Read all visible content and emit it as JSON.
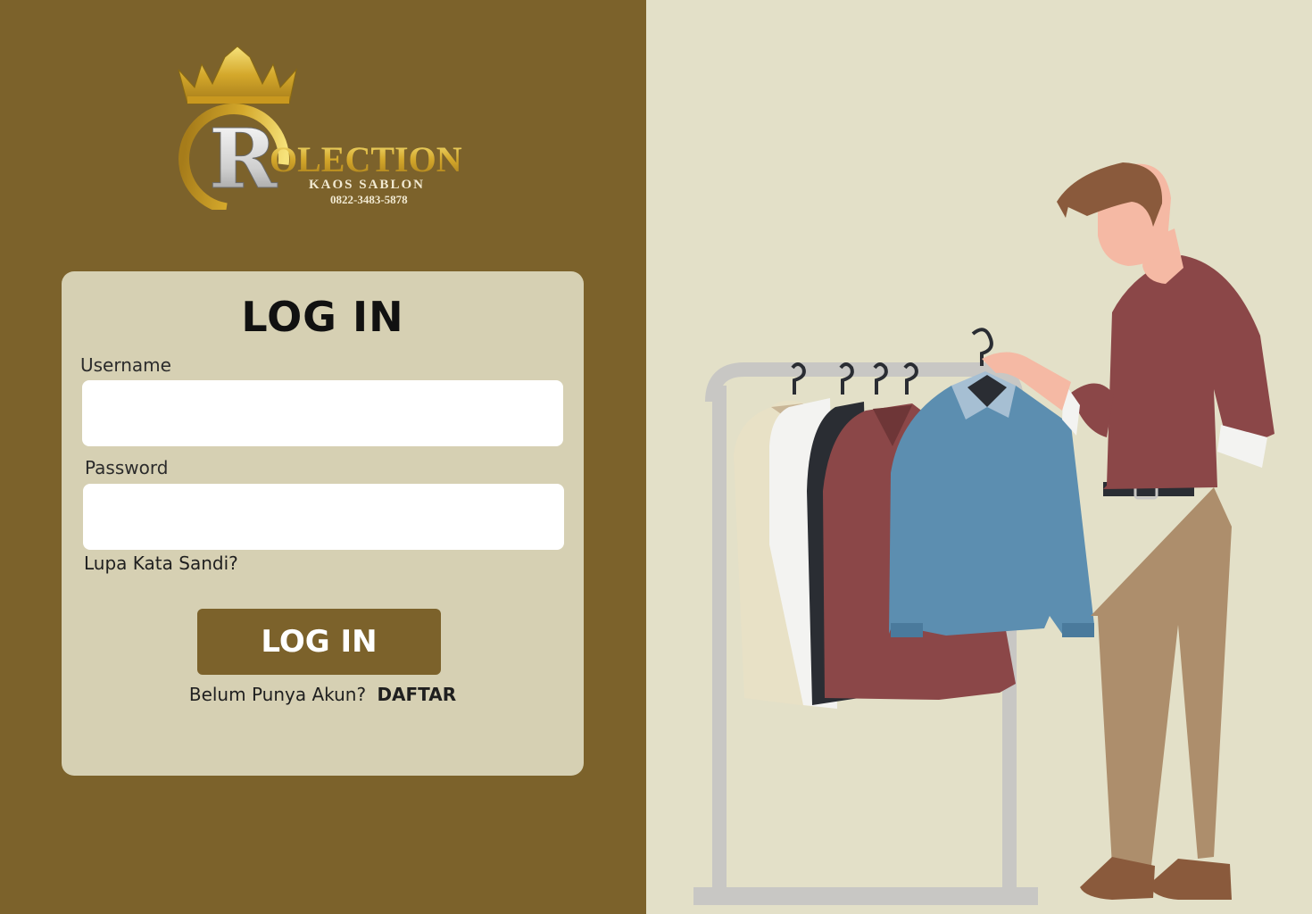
{
  "brand": {
    "logo_initial": "R",
    "logo_name": "OLECTION",
    "logo_tagline": "KAOS SABLON",
    "logo_phone": "0822-3483-5878"
  },
  "login": {
    "title": "LOG IN",
    "username_label": "Username",
    "username_value": "",
    "password_label": "Password",
    "password_value": "",
    "forgot_password": "Lupa Kata Sandi?",
    "submit_label": "LOG IN",
    "no_account_text": "Belum Punya Akun?",
    "register_link": "DAFTAR"
  },
  "colors": {
    "left_background": "#7c622b",
    "right_background": "#e3e0c8",
    "card_background": "#d6d0b3",
    "button_background": "#7c622b",
    "gold": "#d4af37"
  },
  "icons": {
    "logo": "crown-logo",
    "illustration": "man-choosing-clothes-illustration"
  }
}
